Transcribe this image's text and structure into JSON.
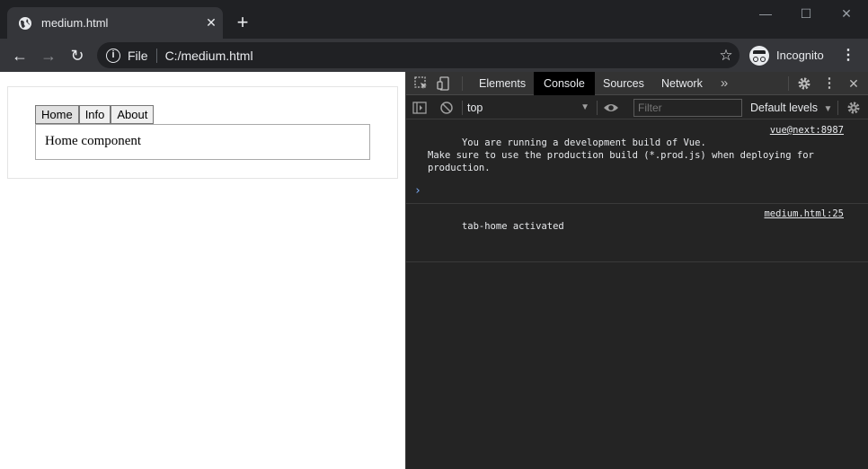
{
  "browser": {
    "tab_title": "medium.html",
    "tab_close": "✕",
    "new_tab": "+",
    "window_controls": {
      "minimize": "—",
      "maximize": "☐",
      "close": "✕"
    },
    "nav": {
      "back": "←",
      "forward": "→",
      "reload": "↻"
    },
    "omnibox": {
      "info": "i",
      "scheme": "File",
      "url": "C:/medium.html",
      "star": "☆"
    },
    "incognito_label": "Incognito",
    "menu": "⋮"
  },
  "page": {
    "tabs": [
      {
        "label": "Home"
      },
      {
        "label": "Info"
      },
      {
        "label": "About"
      }
    ],
    "active_tab": "Home",
    "content": "Home component"
  },
  "devtools": {
    "tabs": [
      {
        "label": "Elements"
      },
      {
        "label": "Console"
      },
      {
        "label": "Sources"
      },
      {
        "label": "Network"
      }
    ],
    "active_tab": "Console",
    "more_tabs": "»",
    "context": "top",
    "context_caret": "▼",
    "filter_placeholder": "Filter",
    "levels_label": "Default levels",
    "levels_caret": "▼",
    "messages": [
      {
        "text": "You are running a development build of Vue.\nMake sure to use the production build (*.prod.js) when deploying for\nproduction.",
        "source": "vue@next:8987"
      },
      {
        "text": "tab-home activated",
        "source": "medium.html:25"
      }
    ],
    "prompt": "›"
  },
  "colors": {
    "chrome_dark": "#202124",
    "chrome_toolbar": "#35363a",
    "devtools_bg": "#242424",
    "devtools_tabs_bg": "#333333",
    "prompt_blue": "#7cacf8"
  }
}
